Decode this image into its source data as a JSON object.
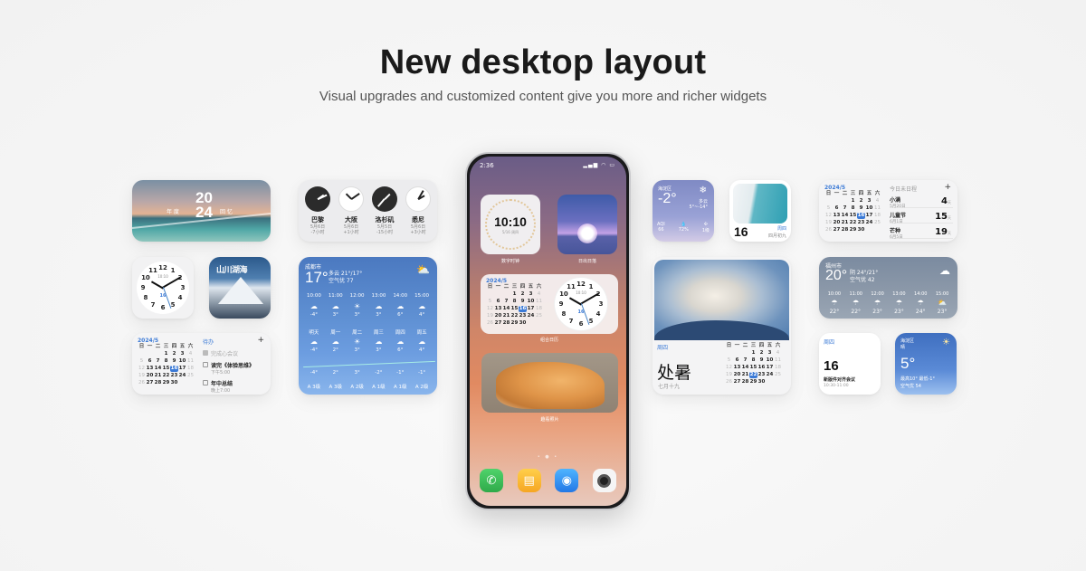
{
  "hero": {
    "title": "New desktop layout",
    "subtitle": "Visual upgrades and customized content give you more and richer widgets"
  },
  "widgets": {
    "year_banner": {
      "year_top": "20",
      "year_bottom": "24",
      "left_label": "年 度",
      "right_label": "回 忆"
    },
    "world_clocks": [
      {
        "city": "巴黎",
        "date": "5月6日",
        "offset": "-7小时",
        "theme": "dark"
      },
      {
        "city": "大阪",
        "date": "5月6日",
        "offset": "+1小时",
        "theme": "light"
      },
      {
        "city": "洛杉矶",
        "date": "5月5日",
        "offset": "-15小时",
        "theme": "dark"
      },
      {
        "city": "悉尼",
        "date": "5月6日",
        "offset": "+3小时",
        "theme": "light"
      }
    ],
    "analog_clock": {
      "numbers": [
        "12",
        "1",
        "2",
        "3",
        "4",
        "5",
        "6",
        "7",
        "8",
        "9",
        "10",
        "11"
      ],
      "digital": "10:10",
      "date": "16"
    },
    "mountain": {
      "title": "山川湖海"
    },
    "cal_todo": {
      "month": "2024/5",
      "weekdays": [
        "日",
        "一",
        "二",
        "三",
        "四",
        "五",
        "六"
      ],
      "days": [
        "",
        "",
        "",
        "1",
        "2",
        "3",
        "4",
        "5",
        "6",
        "7",
        "8",
        "9",
        "10",
        "11",
        "12",
        "13",
        "14",
        "15",
        "16",
        "17",
        "18",
        "19",
        "20",
        "21",
        "22",
        "23",
        "24",
        "25",
        "26",
        "27",
        "28",
        "29",
        "30",
        "",
        ""
      ],
      "today": "16",
      "todo_title": "待办",
      "add": "+",
      "items": [
        {
          "title": "完成心会议",
          "time": "",
          "done": true
        },
        {
          "title": "读完《体验思维》",
          "time": "下午5:00",
          "done": false
        },
        {
          "title": "年中总结",
          "time": "晚上7:00",
          "done": false
        }
      ]
    },
    "weather_large": {
      "city": "成都市",
      "temp": "17°",
      "condition": "多云 21°/17°",
      "aqi": "空气优 77",
      "hours": [
        "10:00",
        "11:00",
        "12:00",
        "13:00",
        "14:00",
        "15:00"
      ],
      "hour_icons": [
        "cloud",
        "cloud",
        "sun",
        "cloud",
        "cloud",
        "cloud"
      ],
      "hour_temps": [
        "-4°",
        "3°",
        "3°",
        "3°",
        "6°",
        "4°"
      ],
      "days": [
        "明天",
        "周一",
        "周二",
        "周三",
        "周四",
        "周五"
      ],
      "day_icons": [
        "cloud",
        "cloud",
        "sun",
        "cloud",
        "cloud",
        "cloud"
      ],
      "day_highs": [
        "-4°",
        "2°",
        "3°",
        "3°",
        "6°",
        "4°"
      ],
      "day_lows": [
        "-4°",
        "2°",
        "3°",
        "-2°",
        "-1°",
        "-1°"
      ],
      "winds": [
        "A 3级",
        "A 3级",
        "A 2级",
        "A 1级",
        "A 1级",
        "A 2级"
      ]
    },
    "weather_small": {
      "city": "海淀区",
      "temp": "-2°",
      "icon": "snow",
      "condition": "多云",
      "range": "5°~-14°",
      "aqi_label": "AQI",
      "aqi": "66",
      "humidity": "72%",
      "wind": "1级"
    },
    "sea_date": {
      "day": "16",
      "weekday": "周四",
      "lunar": "四月初九"
    },
    "countdown": {
      "month": "2024/5",
      "weekdays": [
        "日",
        "一",
        "二",
        "三",
        "四",
        "五",
        "六"
      ],
      "days": [
        "",
        "",
        "",
        "1",
        "2",
        "3",
        "4",
        "5",
        "6",
        "7",
        "8",
        "9",
        "10",
        "11",
        "12",
        "13",
        "14",
        "15",
        "16",
        "17",
        "18",
        "19",
        "20",
        "21",
        "22",
        "23",
        "24",
        "25",
        "26",
        "27",
        "28",
        "29",
        "30",
        "",
        ""
      ],
      "today": "16",
      "title": "今日未日程",
      "add": "+",
      "items": [
        {
          "name": "小满",
          "date": "5月20日",
          "value": "4",
          "unit": "天"
        },
        {
          "name": "儿童节",
          "date": "6月1日",
          "value": "15",
          "unit": "天"
        },
        {
          "name": "芒种",
          "date": "6月5日",
          "value": "19",
          "unit": "天"
        }
      ]
    },
    "solar_term": {
      "weekday": "周四",
      "term": "处暑",
      "lunar": "七月十九",
      "weekdays": [
        "日",
        "一",
        "二",
        "三",
        "四",
        "五",
        "六"
      ],
      "days": [
        "",
        "",
        "",
        "1",
        "2",
        "3",
        "4",
        "5",
        "6",
        "7",
        "8",
        "9",
        "10",
        "11",
        "12",
        "13",
        "14",
        "15",
        "16",
        "17",
        "18",
        "19",
        "20",
        "21",
        "22",
        "23",
        "24",
        "25",
        "26",
        "27",
        "28",
        "29",
        "30",
        "",
        ""
      ],
      "today": "22"
    },
    "weather_medium": {
      "city": "福州市",
      "temp": "20°",
      "condition": "阴 24°/21°",
      "aqi": "空气优 42",
      "hours": [
        "10:00",
        "11:00",
        "12:00",
        "13:00",
        "14:00",
        "15:00"
      ],
      "icons": [
        "rain",
        "rain",
        "rain",
        "rain",
        "rain",
        "sun-cloud"
      ],
      "temps": [
        "22°",
        "22°",
        "23°",
        "23°",
        "24°",
        "23°"
      ]
    },
    "schedule": {
      "weekday": "周四",
      "day": "16",
      "event": "新版件对齐会议",
      "time": "10:30-11:00"
    },
    "weather_tiny": {
      "city": "海淀区",
      "condition": "晴",
      "temp": "5°",
      "range": "最高10° 最低-1°",
      "aqi": "空气优 54"
    }
  },
  "phone": {
    "status_time": "2:36",
    "status_icons": "signal wifi battery",
    "clock_widget": {
      "time": "10:10",
      "date": "5/16 周四",
      "label": "数字时钟"
    },
    "sunrise_widget": {
      "label": "日出日落"
    },
    "calendar_widget": {
      "month": "2024/5",
      "weekdays": [
        "日",
        "一",
        "二",
        "三",
        "四",
        "五",
        "六"
      ],
      "days": [
        "",
        "",
        "",
        "1",
        "2",
        "3",
        "4",
        "5",
        "6",
        "7",
        "8",
        "9",
        "10",
        "11",
        "12",
        "13",
        "14",
        "15",
        "16",
        "17",
        "18",
        "19",
        "20",
        "21",
        "22",
        "23",
        "24",
        "25",
        "26",
        "27",
        "28",
        "29",
        "30",
        "",
        ""
      ],
      "today": "16",
      "clock_digital": "10:10",
      "clock_date": "16",
      "label": "组合日历"
    },
    "photo_widget": {
      "label": "趣看照片"
    },
    "page_dots": "• ● •",
    "dock": [
      {
        "name": "phone",
        "glyph": "✆"
      },
      {
        "name": "notes",
        "glyph": "▤"
      },
      {
        "name": "browser",
        "glyph": "◉"
      },
      {
        "name": "camera",
        "glyph": ""
      }
    ]
  }
}
